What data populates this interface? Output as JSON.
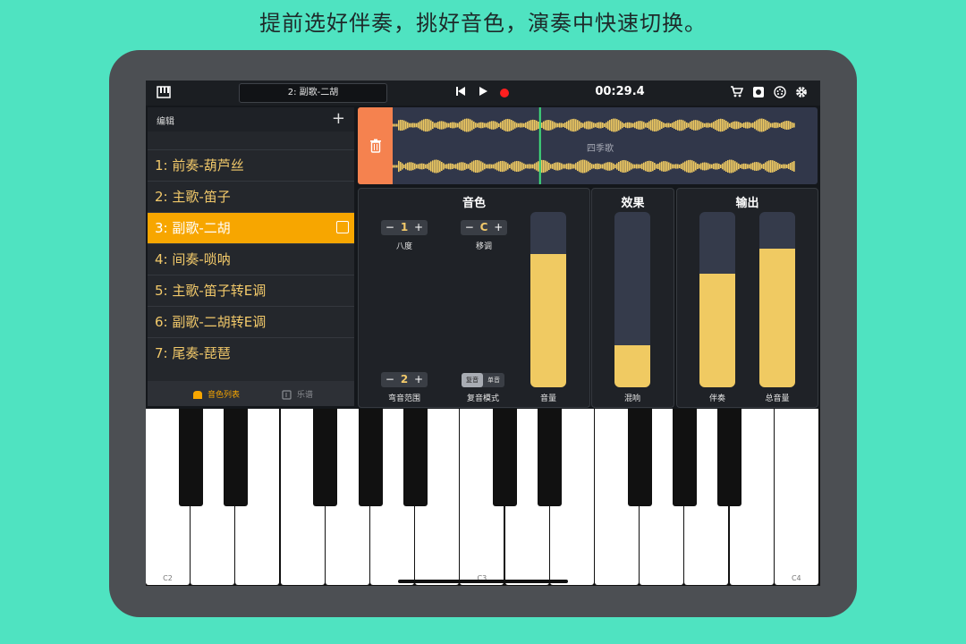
{
  "caption": "提前选好伴奏，挑好音色，演奏中快速切换。",
  "topbar": {
    "preset": "2: 副歌-二胡",
    "time": "00:29.4",
    "icons": [
      "piano-icon",
      "skip-back-icon",
      "play-icon",
      "record-icon",
      "cart-icon",
      "screen-icon",
      "midi-icon",
      "gear-icon"
    ]
  },
  "left_panel": {
    "title": "编辑",
    "add": "+",
    "items": [
      {
        "label": "1: 前奏-葫芦丝",
        "active": false
      },
      {
        "label": "2: 主歌-笛子",
        "active": false
      },
      {
        "label": "3: 副歌-二胡",
        "active": true
      },
      {
        "label": "4: 间奏-唢呐",
        "active": false
      },
      {
        "label": "5: 主歌-笛子转E调",
        "active": false
      },
      {
        "label": "6: 副歌-二胡转E调",
        "active": false
      },
      {
        "label": "7: 尾奏-琵琶",
        "active": false
      }
    ],
    "tabs": [
      {
        "label": "音色列表",
        "active": true,
        "color": "#f7a600"
      },
      {
        "label": "乐谱",
        "active": false,
        "color": "#8a8d92"
      }
    ]
  },
  "waveform": {
    "song": "四季歌",
    "playhead": 0.33,
    "wave_color": "#f0ca62",
    "playhead_color": "#3fe07c"
  },
  "timbre": {
    "title": "音色",
    "octave": {
      "label": "八度",
      "value": "1",
      "minus": "−",
      "plus": "+"
    },
    "transpose": {
      "label": "移调",
      "value": "C",
      "minus": "−",
      "plus": "+"
    },
    "bend": {
      "label": "弯音范围",
      "value": "2",
      "minus": "−",
      "plus": "+"
    },
    "poly": {
      "label": "复音模式",
      "options": [
        "复音",
        "单音"
      ],
      "selected": 0
    },
    "volume": {
      "label": "音量",
      "level": 0.76
    }
  },
  "effects": {
    "title": "效果",
    "reverb": {
      "label": "混响",
      "level": 0.24
    }
  },
  "output": {
    "title": "输出",
    "accompaniment": {
      "label": "伴奏",
      "level": 0.65
    },
    "master": {
      "label": "总音量",
      "level": 0.79
    }
  },
  "keyboard": {
    "labels": {
      "0": "C2",
      "7": "C3",
      "14": "C4"
    }
  }
}
